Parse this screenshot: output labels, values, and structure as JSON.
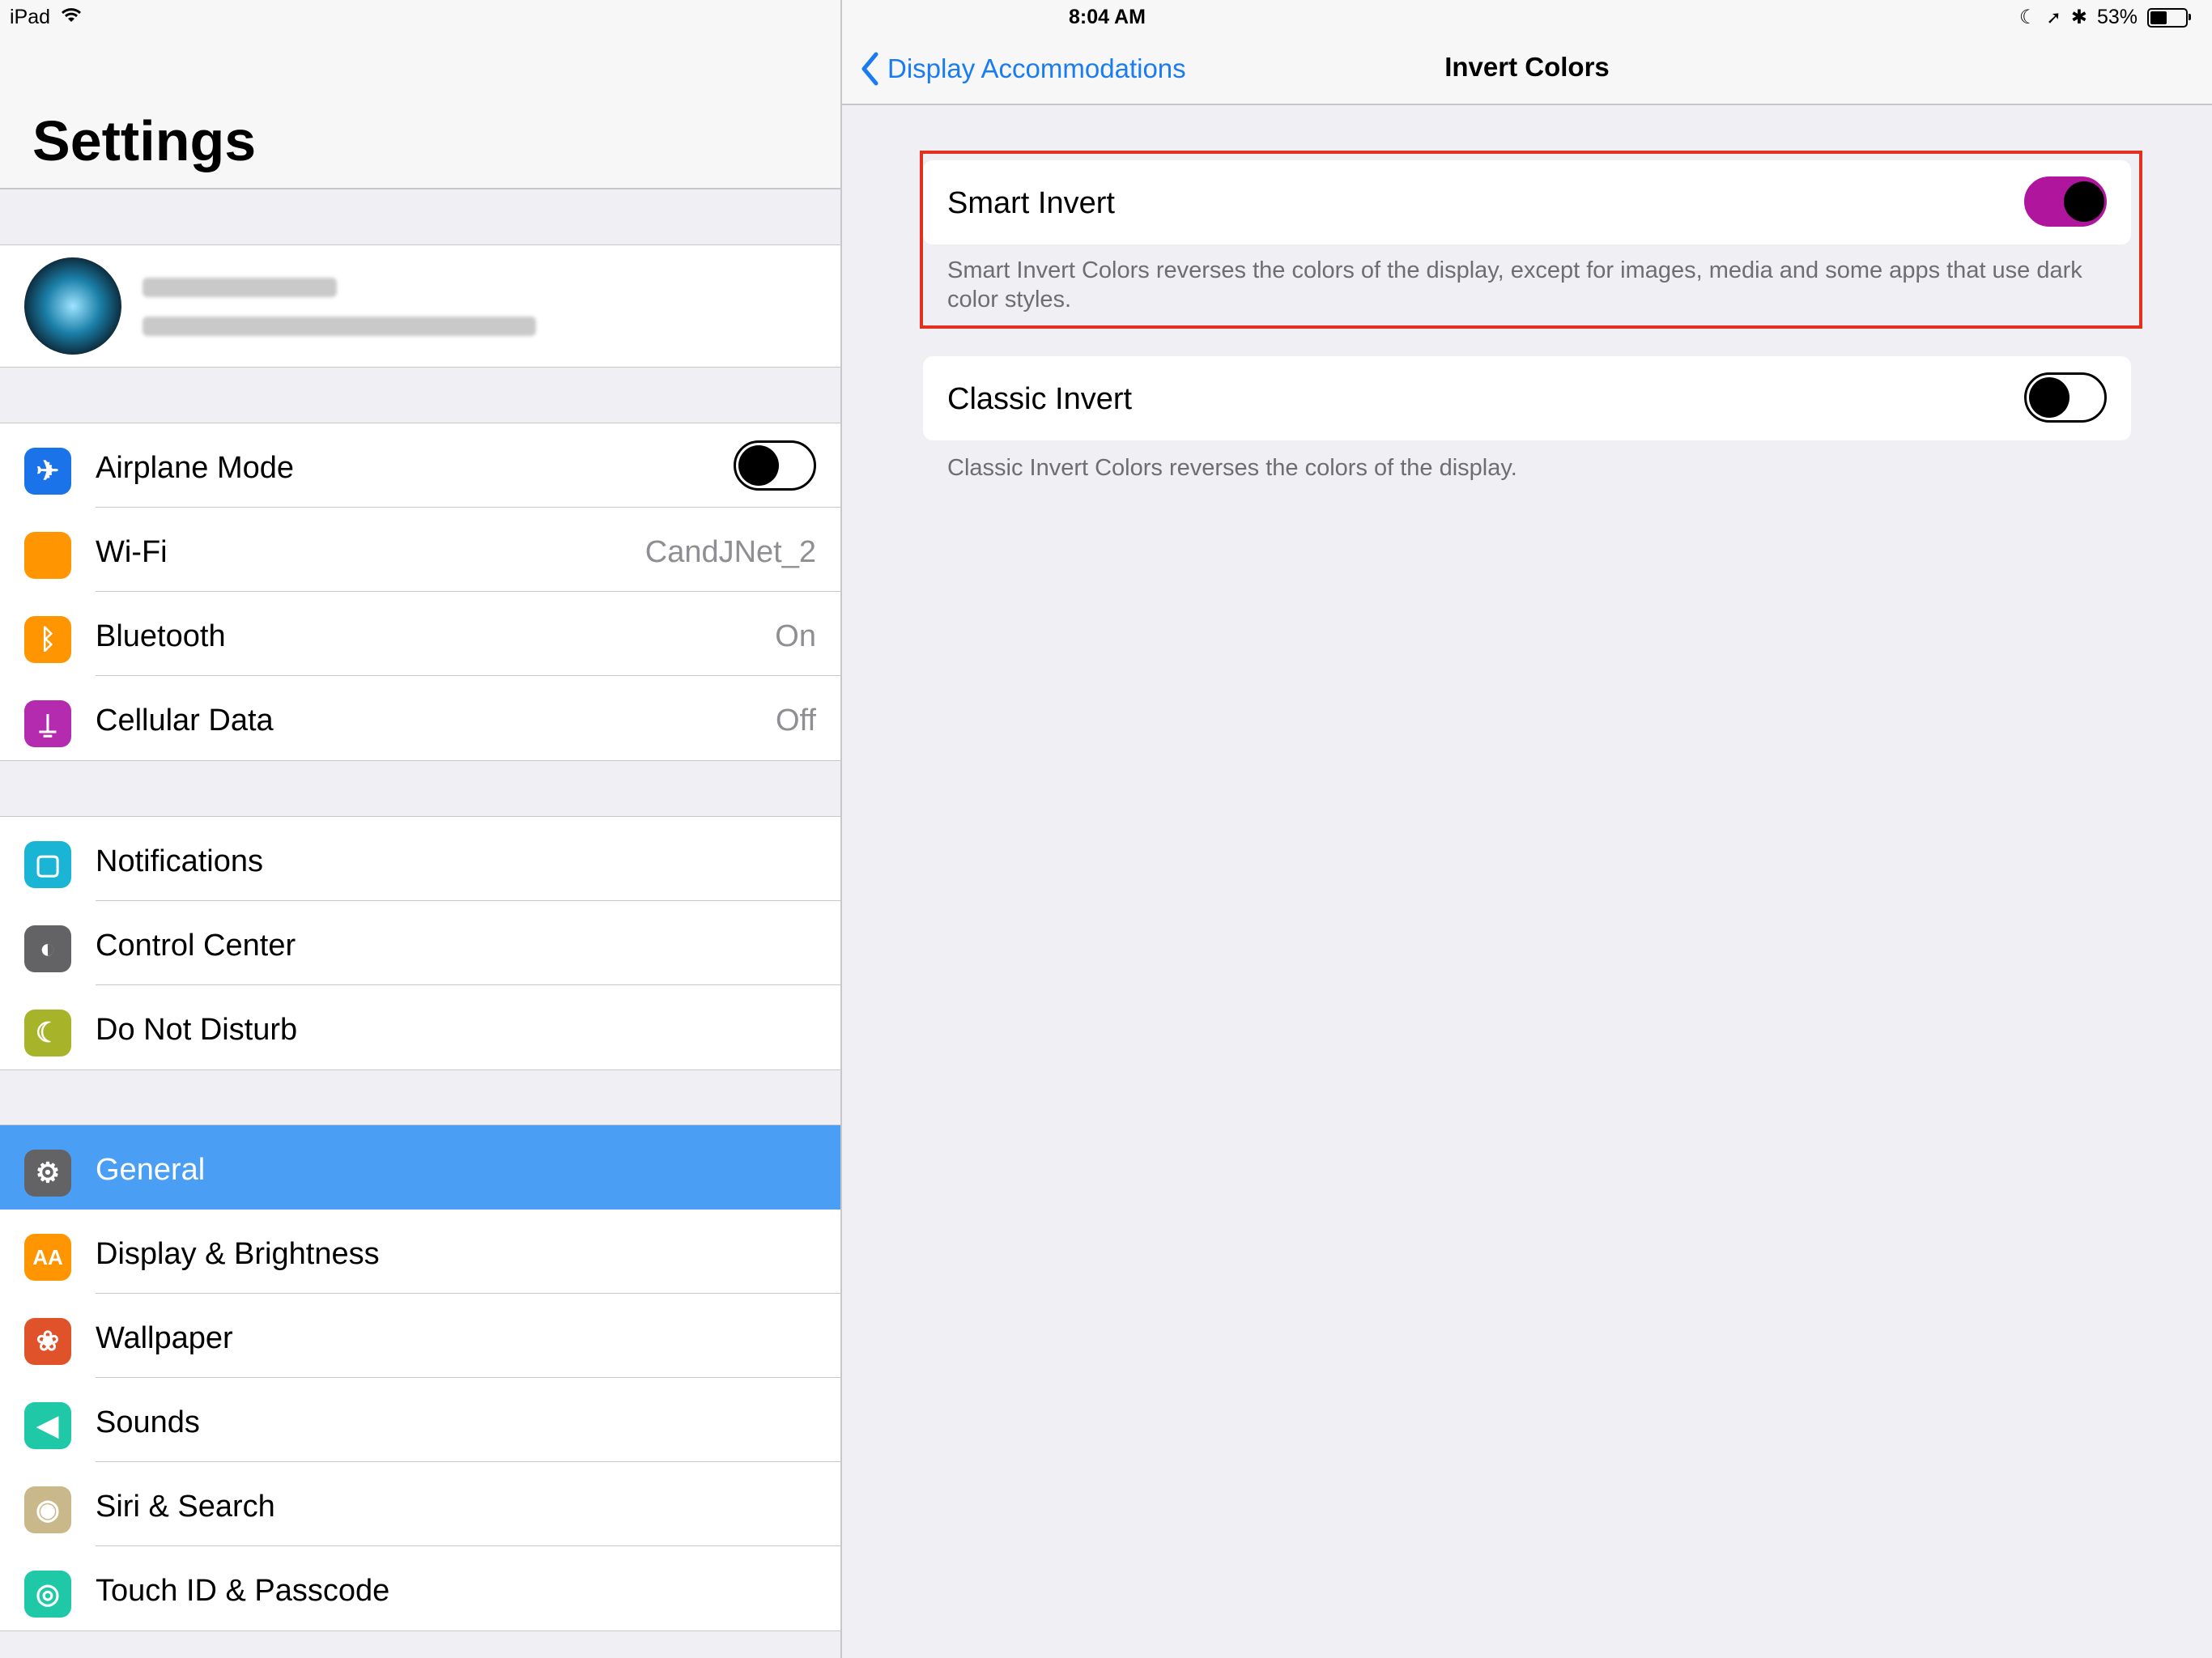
{
  "status_bar": {
    "device": "iPad",
    "time": "8:04 AM",
    "battery": "53%",
    "battery_level": 0.53
  },
  "master": {
    "title": "Settings",
    "group1": [
      {
        "label": "Airplane Mode",
        "icon": "airplane-icon",
        "color": "#1a73e8",
        "toggle": "off"
      },
      {
        "label": "Wi-Fi",
        "icon": "wifi-icon",
        "color": "#ff9500",
        "value": "CandJNet_2"
      },
      {
        "label": "Bluetooth",
        "icon": "bluetooth-icon",
        "color": "#ff9500",
        "value": "On"
      },
      {
        "label": "Cellular Data",
        "icon": "antenna-icon",
        "color": "#b42bb0",
        "value": "Off"
      }
    ],
    "group2": [
      {
        "label": "Notifications",
        "icon": "notifications-icon",
        "color": "#1ab5d4"
      },
      {
        "label": "Control Center",
        "icon": "switches-icon",
        "color": "#636366"
      },
      {
        "label": "Do Not Disturb",
        "icon": "moon-icon",
        "color": "#a7b42a"
      }
    ],
    "group3": [
      {
        "label": "General",
        "icon": "gear-icon",
        "color": "#636366",
        "selected": true
      },
      {
        "label": "Display & Brightness",
        "icon": "text-size-icon",
        "color": "#ff9500"
      },
      {
        "label": "Wallpaper",
        "icon": "flower-icon",
        "color": "#e0532a"
      },
      {
        "label": "Sounds",
        "icon": "speaker-icon",
        "color": "#1fc9a8"
      },
      {
        "label": "Siri & Search",
        "icon": "siri-icon",
        "color": "#c9b88a"
      },
      {
        "label": "Touch ID & Passcode",
        "icon": "fingerprint-icon",
        "color": "#1fc9a8"
      }
    ]
  },
  "detail": {
    "back_label": "Display Accommodations",
    "title": "Invert Colors",
    "smart_invert": {
      "label": "Smart Invert",
      "state": "on",
      "footer": "Smart Invert Colors reverses the colors of the display, except for images, media and some apps that use dark color styles."
    },
    "classic_invert": {
      "label": "Classic Invert",
      "state": "off",
      "footer": "Classic Invert Colors reverses the colors of the display."
    },
    "highlight_color": "#e3301f",
    "accent": "#1a7cf2"
  }
}
